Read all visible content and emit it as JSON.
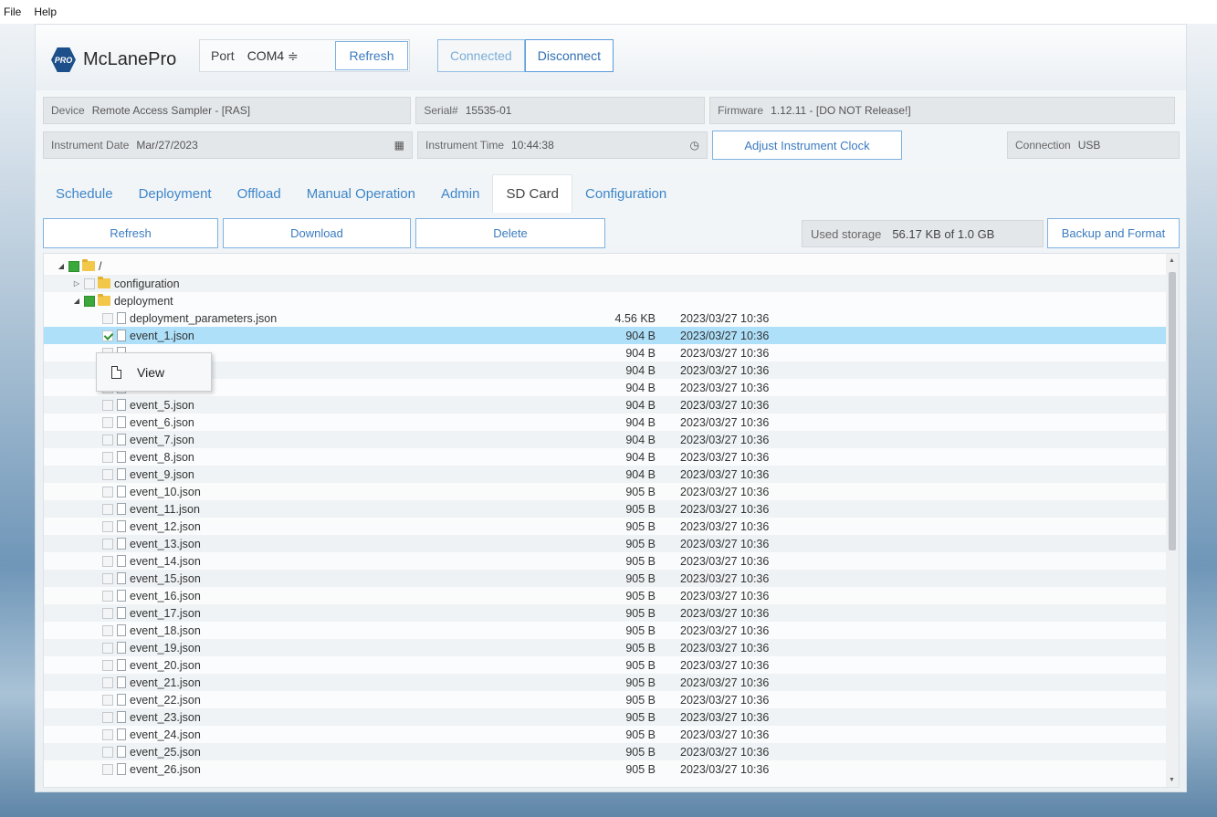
{
  "menu": {
    "file": "File",
    "help": "Help"
  },
  "header": {
    "logo_badge": "PRO",
    "logo_text": "McLanePro",
    "port_label": "Port",
    "port_value": "COM4 ≑",
    "refresh_label": "Refresh",
    "connected_label": "Connected",
    "disconnect_label": "Disconnect"
  },
  "info": {
    "device_label": "Device",
    "device_value": "Remote Access Sampler - [RAS]",
    "serial_label": "Serial#",
    "serial_value": "15535-01",
    "firmware_label": "Firmware",
    "firmware_value": "1.12.11 - [DO NOT Release!]",
    "date_label": "Instrument Date",
    "date_value": "Mar/27/2023",
    "time_label": "Instrument Time",
    "time_value": "10:44:38",
    "adjust_clock_label": "Adjust Instrument Clock",
    "connection_label": "Connection",
    "connection_value": "USB"
  },
  "tabs": [
    "Schedule",
    "Deployment",
    "Offload",
    "Manual Operation",
    "Admin",
    "SD Card",
    "Configuration"
  ],
  "active_tab": "SD Card",
  "toolbar": {
    "refresh_label": "Refresh",
    "download_label": "Download",
    "delete_label": "Delete",
    "used_storage_label": "Used storage",
    "used_storage_value": "56.17 KB of 1.0 GB",
    "backup_label": "Backup and Format"
  },
  "tree": {
    "root": "/",
    "folders": [
      "configuration",
      "deployment"
    ],
    "files": [
      {
        "name": "deployment_parameters.json",
        "size": "4.56 KB",
        "date": "2023/03/27 10:36"
      },
      {
        "name": "event_1.json",
        "size": "904 B",
        "date": "2023/03/27 10:36"
      },
      {
        "name": "",
        "size": "904 B",
        "date": "2023/03/27 10:36"
      },
      {
        "name": "",
        "size": "904 B",
        "date": "2023/03/27 10:36"
      },
      {
        "name": "",
        "size": "904 B",
        "date": "2023/03/27 10:36"
      },
      {
        "name": "event_5.json",
        "size": "904 B",
        "date": "2023/03/27 10:36"
      },
      {
        "name": "event_6.json",
        "size": "904 B",
        "date": "2023/03/27 10:36"
      },
      {
        "name": "event_7.json",
        "size": "904 B",
        "date": "2023/03/27 10:36"
      },
      {
        "name": "event_8.json",
        "size": "904 B",
        "date": "2023/03/27 10:36"
      },
      {
        "name": "event_9.json",
        "size": "904 B",
        "date": "2023/03/27 10:36"
      },
      {
        "name": "event_10.json",
        "size": "905 B",
        "date": "2023/03/27 10:36"
      },
      {
        "name": "event_11.json",
        "size": "905 B",
        "date": "2023/03/27 10:36"
      },
      {
        "name": "event_12.json",
        "size": "905 B",
        "date": "2023/03/27 10:36"
      },
      {
        "name": "event_13.json",
        "size": "905 B",
        "date": "2023/03/27 10:36"
      },
      {
        "name": "event_14.json",
        "size": "905 B",
        "date": "2023/03/27 10:36"
      },
      {
        "name": "event_15.json",
        "size": "905 B",
        "date": "2023/03/27 10:36"
      },
      {
        "name": "event_16.json",
        "size": "905 B",
        "date": "2023/03/27 10:36"
      },
      {
        "name": "event_17.json",
        "size": "905 B",
        "date": "2023/03/27 10:36"
      },
      {
        "name": "event_18.json",
        "size": "905 B",
        "date": "2023/03/27 10:36"
      },
      {
        "name": "event_19.json",
        "size": "905 B",
        "date": "2023/03/27 10:36"
      },
      {
        "name": "event_20.json",
        "size": "905 B",
        "date": "2023/03/27 10:36"
      },
      {
        "name": "event_21.json",
        "size": "905 B",
        "date": "2023/03/27 10:36"
      },
      {
        "name": "event_22.json",
        "size": "905 B",
        "date": "2023/03/27 10:36"
      },
      {
        "name": "event_23.json",
        "size": "905 B",
        "date": "2023/03/27 10:36"
      },
      {
        "name": "event_24.json",
        "size": "905 B",
        "date": "2023/03/27 10:36"
      },
      {
        "name": "event_25.json",
        "size": "905 B",
        "date": "2023/03/27 10:36"
      },
      {
        "name": "event_26.json",
        "size": "905 B",
        "date": "2023/03/27 10:36"
      }
    ]
  },
  "context_menu": {
    "view_label": "View"
  },
  "icons": {
    "calendar": "calendar-icon",
    "clock": "clock-icon",
    "folder": "folder-icon",
    "file": "file-icon",
    "document": "document-icon"
  },
  "colors": {
    "accent": "#3b7bbf",
    "selected_row": "#aee0fa",
    "check_green": "#3aa83a",
    "folder": "#f3c74a"
  }
}
